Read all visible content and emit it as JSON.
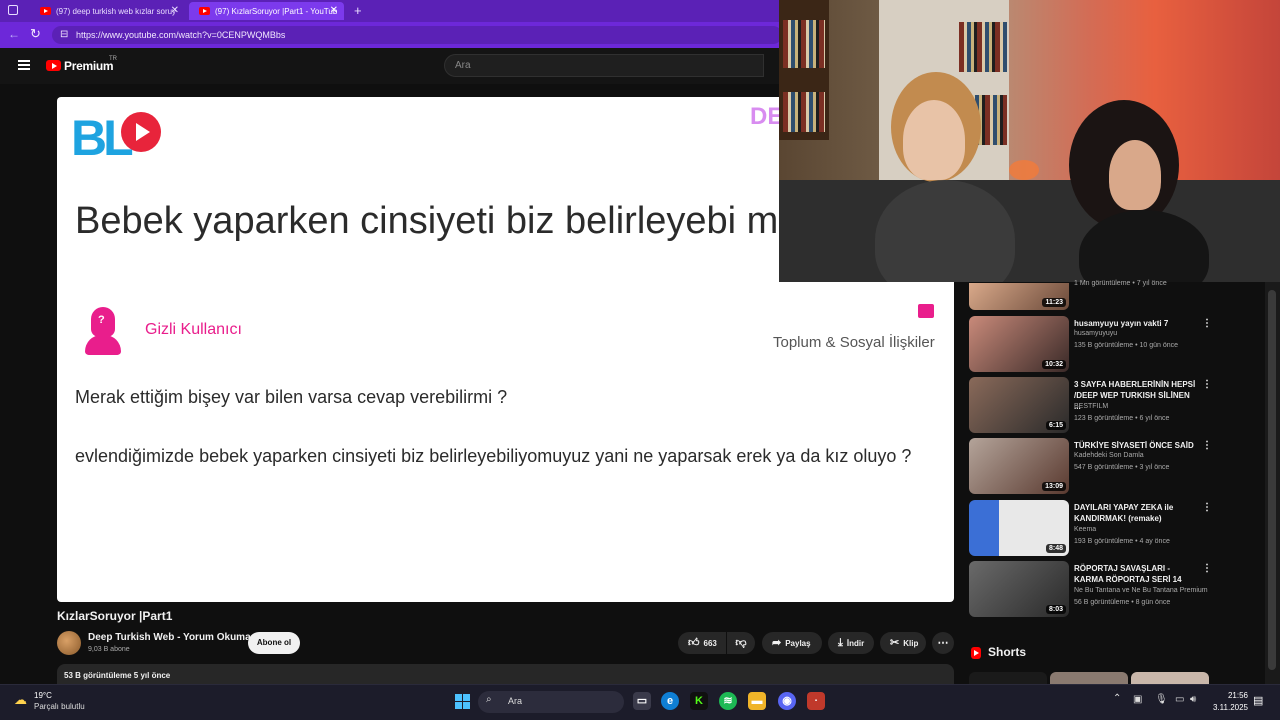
{
  "browser": {
    "tabs": [
      {
        "label": "(97) deep turkish web kızlar soruy",
        "active": false
      },
      {
        "label": "(97) KızlarSoruyor |Part1 - YouTub",
        "active": true
      }
    ],
    "new_tab": "+",
    "url": "https://www.youtube.com/watch?v=0CENPWQMBbs"
  },
  "youtube": {
    "brand": "Premium",
    "brand_sup": "TR",
    "search_placeholder": "Ara"
  },
  "card": {
    "logo_text": "BL",
    "corner_tag": "DE",
    "question_title": "Bebek yaparken cinsiyeti biz belirleyebi muyuz?",
    "user_name": "Gizli Kullanıcı",
    "category": "Toplum & Sosyal İlişkiler",
    "line1": "Merak ettiğim bişey var bilen varsa cevap verebilirmi ?",
    "line2": "evlendiğimizde bebek yaparken cinsiyeti biz belirleyebiliyomuyuz yani ne yaparsak erek ya da kız oluyo ?"
  },
  "video": {
    "title": "KızlarSoruyor |Part1",
    "channel": "Deep Turkish Web - Yorum Okuma",
    "subs": "9,03 B abone",
    "subscribe": "Abone ol",
    "likes": "663",
    "share": "Paylaş",
    "download": "İndir",
    "clip": "Klip",
    "views_date": "53 B görüntüleme  5 yıl önce"
  },
  "recommended": [
    {
      "title": "",
      "channel": "",
      "meta": "1 Mn görüntüleme • 7 yıl önce",
      "duration": "11:23",
      "colors": [
        "#d9a98a",
        "#6b4a3a"
      ]
    },
    {
      "title": "husamyuyu yayın vakti 7",
      "channel": "husamyuyuyu",
      "meta": "135 B görüntüleme • 10 gün önce",
      "duration": "10:32",
      "colors": [
        "#c98a7a",
        "#3a2a28"
      ]
    },
    {
      "title": "3 SAYFA HABERLERİNİN HEPSİ /DEEP WEP TURKISH SİLİNEN ...",
      "channel": "BESTFILM",
      "meta": "123 B görüntüleme • 6 yıl önce",
      "duration": "6:15",
      "colors": [
        "#8a6a5a",
        "#2a2a2a"
      ]
    },
    {
      "title": "TÜRKİYE SİYASETİ ÖNCE SAİD",
      "channel": "Kadehdeki Son Damla",
      "meta": "547 B görüntüleme • 3 yıl önce",
      "duration": "13:09",
      "colors": [
        "#b4a49a",
        "#5a3a30"
      ]
    },
    {
      "title": "DAYILARI YAPAY ZEKA ile KANDIRMAK! (remake)",
      "channel": "Keema",
      "meta": "193 B görüntüleme • 4 ay önce",
      "duration": "8:48",
      "colors": [
        "#3b6fd6",
        "#e8e8e8"
      ]
    },
    {
      "title": "RÖPORTAJ SAVAŞLARI - KARMA RÖPORTAJ SERİ 14",
      "channel": "Ne Bu Tantana ve Ne Bu Tantana Premium",
      "meta": "56 B görüntüleme • 8 gün önce",
      "duration": "8:03",
      "colors": [
        "#6a6a6a",
        "#2a2a2a"
      ]
    }
  ],
  "shorts_label": "Shorts",
  "taskbar": {
    "temp": "19°C",
    "condition": "Parçalı bulutlu",
    "search": "Ara",
    "time": "21:56",
    "date": "3.11.2025"
  }
}
